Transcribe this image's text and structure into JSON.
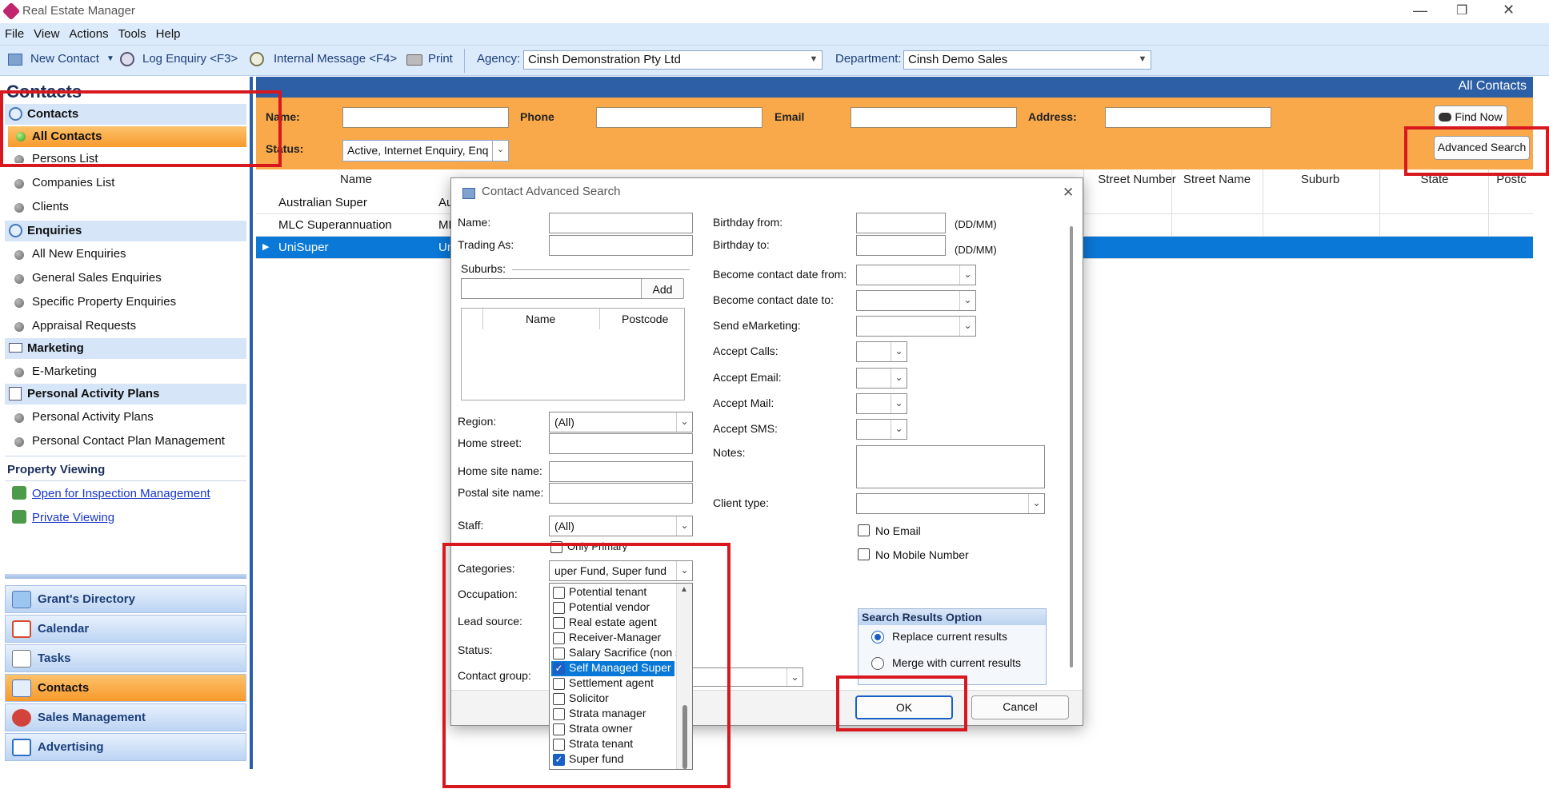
{
  "window": {
    "title": "Real Estate Manager"
  },
  "menu": [
    "File",
    "View",
    "Actions",
    "Tools",
    "Help"
  ],
  "toolbar": {
    "new_contact": "New Contact",
    "log_enquiry": "Log Enquiry <F3>",
    "internal_message": "Internal Message <F4>",
    "print": "Print",
    "agency_label": "Agency:",
    "agency_value": "Cinsh Demonstration Pty Ltd",
    "department_label": "Department:",
    "department_value": "Cinsh Demo Sales"
  },
  "sidebar": {
    "title": "Contacts",
    "contacts_header": "Contacts",
    "all_contacts": "All Contacts",
    "persons_list": "Persons List",
    "companies_list": "Companies List",
    "clients": "Clients",
    "enquiries_header": "Enquiries",
    "enquiries": [
      "All New Enquiries",
      "General Sales Enquiries",
      "Specific Property Enquiries",
      "Appraisal Requests"
    ],
    "marketing_header": "Marketing",
    "emarketing": "E-Marketing",
    "pap_header": "Personal Activity Plans",
    "pap_items": [
      "Personal Activity Plans",
      "Personal Contact Plan Management"
    ],
    "property_viewing": "Property Viewing",
    "open_inspection": "Open for Inspection Management",
    "private_viewing": "Private Viewing",
    "big_buttons": [
      "Grant's Directory",
      "Calendar",
      "Tasks",
      "Contacts",
      "Sales Management",
      "Advertising"
    ]
  },
  "main": {
    "header": "All Contacts",
    "search": {
      "name_label": "Name:",
      "phone_label": "Phone",
      "email_label": "Email",
      "address_label": "Address:",
      "status_label": "Status:",
      "status_value": "Active, Internet Enquiry, Enq",
      "find_now": "Find Now",
      "advanced_search": "Advanced Search"
    },
    "columns": [
      "Name",
      "Street Number",
      "Street Name",
      "Suburb",
      "State",
      "Postc"
    ],
    "rows": [
      {
        "name": "Australian Super",
        "trading": "Au"
      },
      {
        "name": "MLC Superannuation",
        "trading": "ML"
      },
      {
        "name": "UniSuper",
        "trading": "Un"
      }
    ]
  },
  "dialog": {
    "title": "Contact Advanced Search",
    "name_label": "Name:",
    "trading_label": "Trading As:",
    "suburbs_label": "Suburbs:",
    "add_button": "Add",
    "suburb_cols": [
      "Name",
      "Postcode"
    ],
    "region_label": "Region:",
    "region_value": "(All)",
    "home_street_label": "Home street:",
    "home_site_label": "Home site name:",
    "postal_site_label": "Postal site name:",
    "staff_label": "Staff:",
    "staff_value": "(All)",
    "only_primary": "Only Primary",
    "categories_label": "Categories:",
    "categories_value": "uper Fund, Super fund",
    "occupation_label": "Occupation:",
    "lead_source_label": "Lead source:",
    "status_label": "Status:",
    "contact_group_label": "Contact group:",
    "category_options": [
      {
        "label": "Potential tenant",
        "checked": false
      },
      {
        "label": "Potential vendor",
        "checked": false
      },
      {
        "label": "Real estate agent",
        "checked": false
      },
      {
        "label": "Receiver-Manager",
        "checked": false
      },
      {
        "label": "Salary Sacrifice (non su",
        "checked": false
      },
      {
        "label": "Self Managed Super F",
        "checked": true,
        "highlighted": true
      },
      {
        "label": "Settlement agent",
        "checked": false
      },
      {
        "label": "Solicitor",
        "checked": false
      },
      {
        "label": "Strata manager",
        "checked": false
      },
      {
        "label": "Strata owner",
        "checked": false
      },
      {
        "label": "Strata tenant",
        "checked": false
      },
      {
        "label": "Super fund",
        "checked": true
      }
    ],
    "birthday_from": "Birthday from:",
    "birthday_to": "Birthday to:",
    "ddmm": "(DD/MM)",
    "become_from": "Become contact date  from:",
    "become_to": "Become contact date to:",
    "send_emarketing": "Send eMarketing:",
    "accept_calls": "Accept Calls:",
    "accept_email": "Accept Email:",
    "accept_mail": "Accept Mail:",
    "accept_sms": "Accept SMS:",
    "notes": "Notes:",
    "client_type": "Client type:",
    "no_email": "No Email",
    "no_mobile": "No Mobile Number",
    "results_option_title": "Search Results Option",
    "replace_results": "Replace current results",
    "merge_results": "Merge with current results",
    "ok": "OK",
    "cancel": "Cancel"
  },
  "colors": {
    "accent": "#2c5fa6",
    "search_bar": "#f9a94a",
    "selected_row": "#0a78d7",
    "annotation": "#d7191f"
  }
}
